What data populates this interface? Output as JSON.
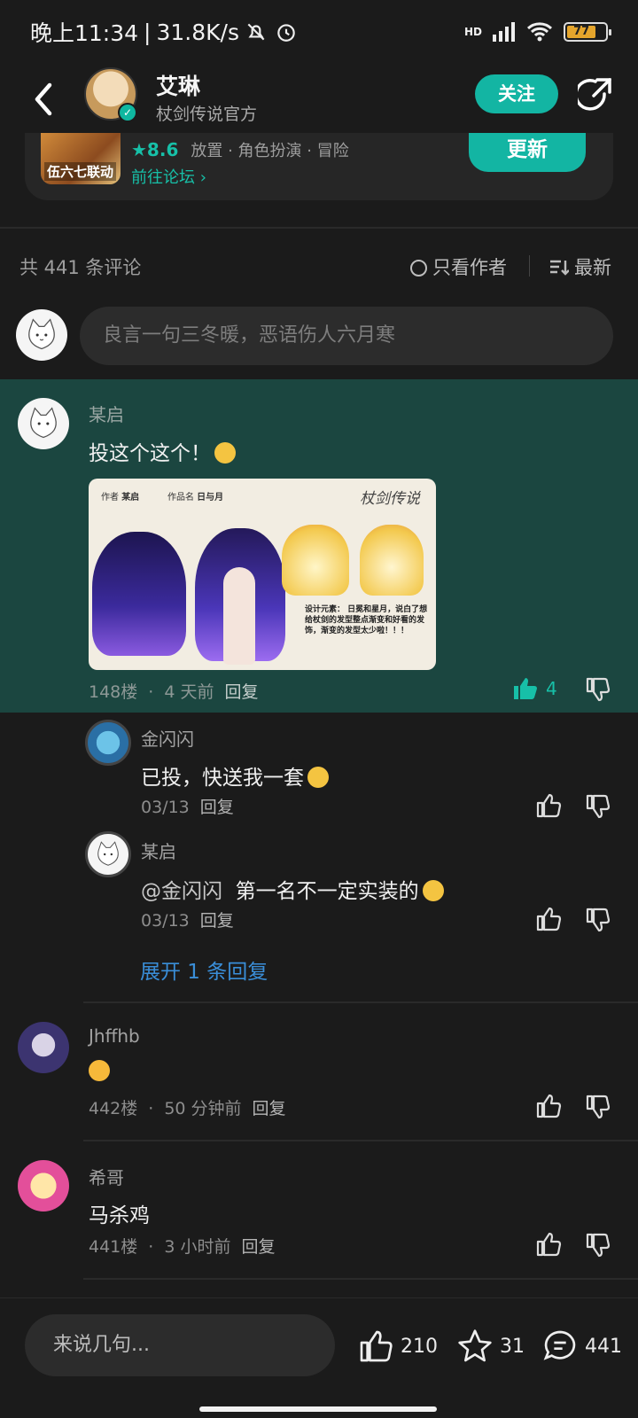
{
  "status": {
    "time": "晚上11:34",
    "speed": "31.8K/s",
    "signal": "HD",
    "battery": "77"
  },
  "header": {
    "name": "艾琳",
    "subtitle": "杖剑传说官方",
    "follow": "关注"
  },
  "game": {
    "icon_text": "伍六七联动",
    "score": "★8.6",
    "tags": "放置 · 角色扮演 · 冒险",
    "forum": "前往论坛",
    "update": "更新"
  },
  "comments_bar": {
    "count": "共 441 条评论",
    "only_author": "只看作者",
    "sort": "最新"
  },
  "quick_input": {
    "placeholder": "良言一句三冬暖，恶语伤人六月寒"
  },
  "comments": [
    {
      "author": "某启",
      "text": "投这个这个！",
      "floor": "148楼",
      "time": "4 天前",
      "reply": "回复",
      "likes": "4",
      "image": {
        "author_label": "作者",
        "author": "某启",
        "work_label": "作品名",
        "work": "日与月",
        "logo": "杖剑传说",
        "desc": "设计元素：\n日冕和星月，说白了想给杖剑的发型整点渐变和好看的发饰，渐变的发型太少啦！！！"
      }
    },
    {
      "author": "金闪闪",
      "text": "已投，快送我一套",
      "time": "03/13",
      "reply": "回复"
    },
    {
      "author": "某启",
      "mention": "@金闪闪",
      "text": "第一名不一定实装的",
      "time": "03/13",
      "reply": "回复"
    },
    {
      "expand": "展开 1 条回复"
    },
    {
      "author": "Jhffhb",
      "text": "",
      "floor": "442楼",
      "time": "50 分钟前",
      "reply": "回复"
    },
    {
      "author": "希哥",
      "text": "马杀鸡",
      "floor": "441楼",
      "time": "3 小时前",
      "reply": "回复"
    }
  ],
  "bottom": {
    "say": "来说几句...",
    "likes": "210",
    "stars": "31",
    "comments": "441"
  },
  "colors": {
    "accent": "#13b5a3",
    "highlight": "#1b4640",
    "link": "#3a8ed8"
  }
}
